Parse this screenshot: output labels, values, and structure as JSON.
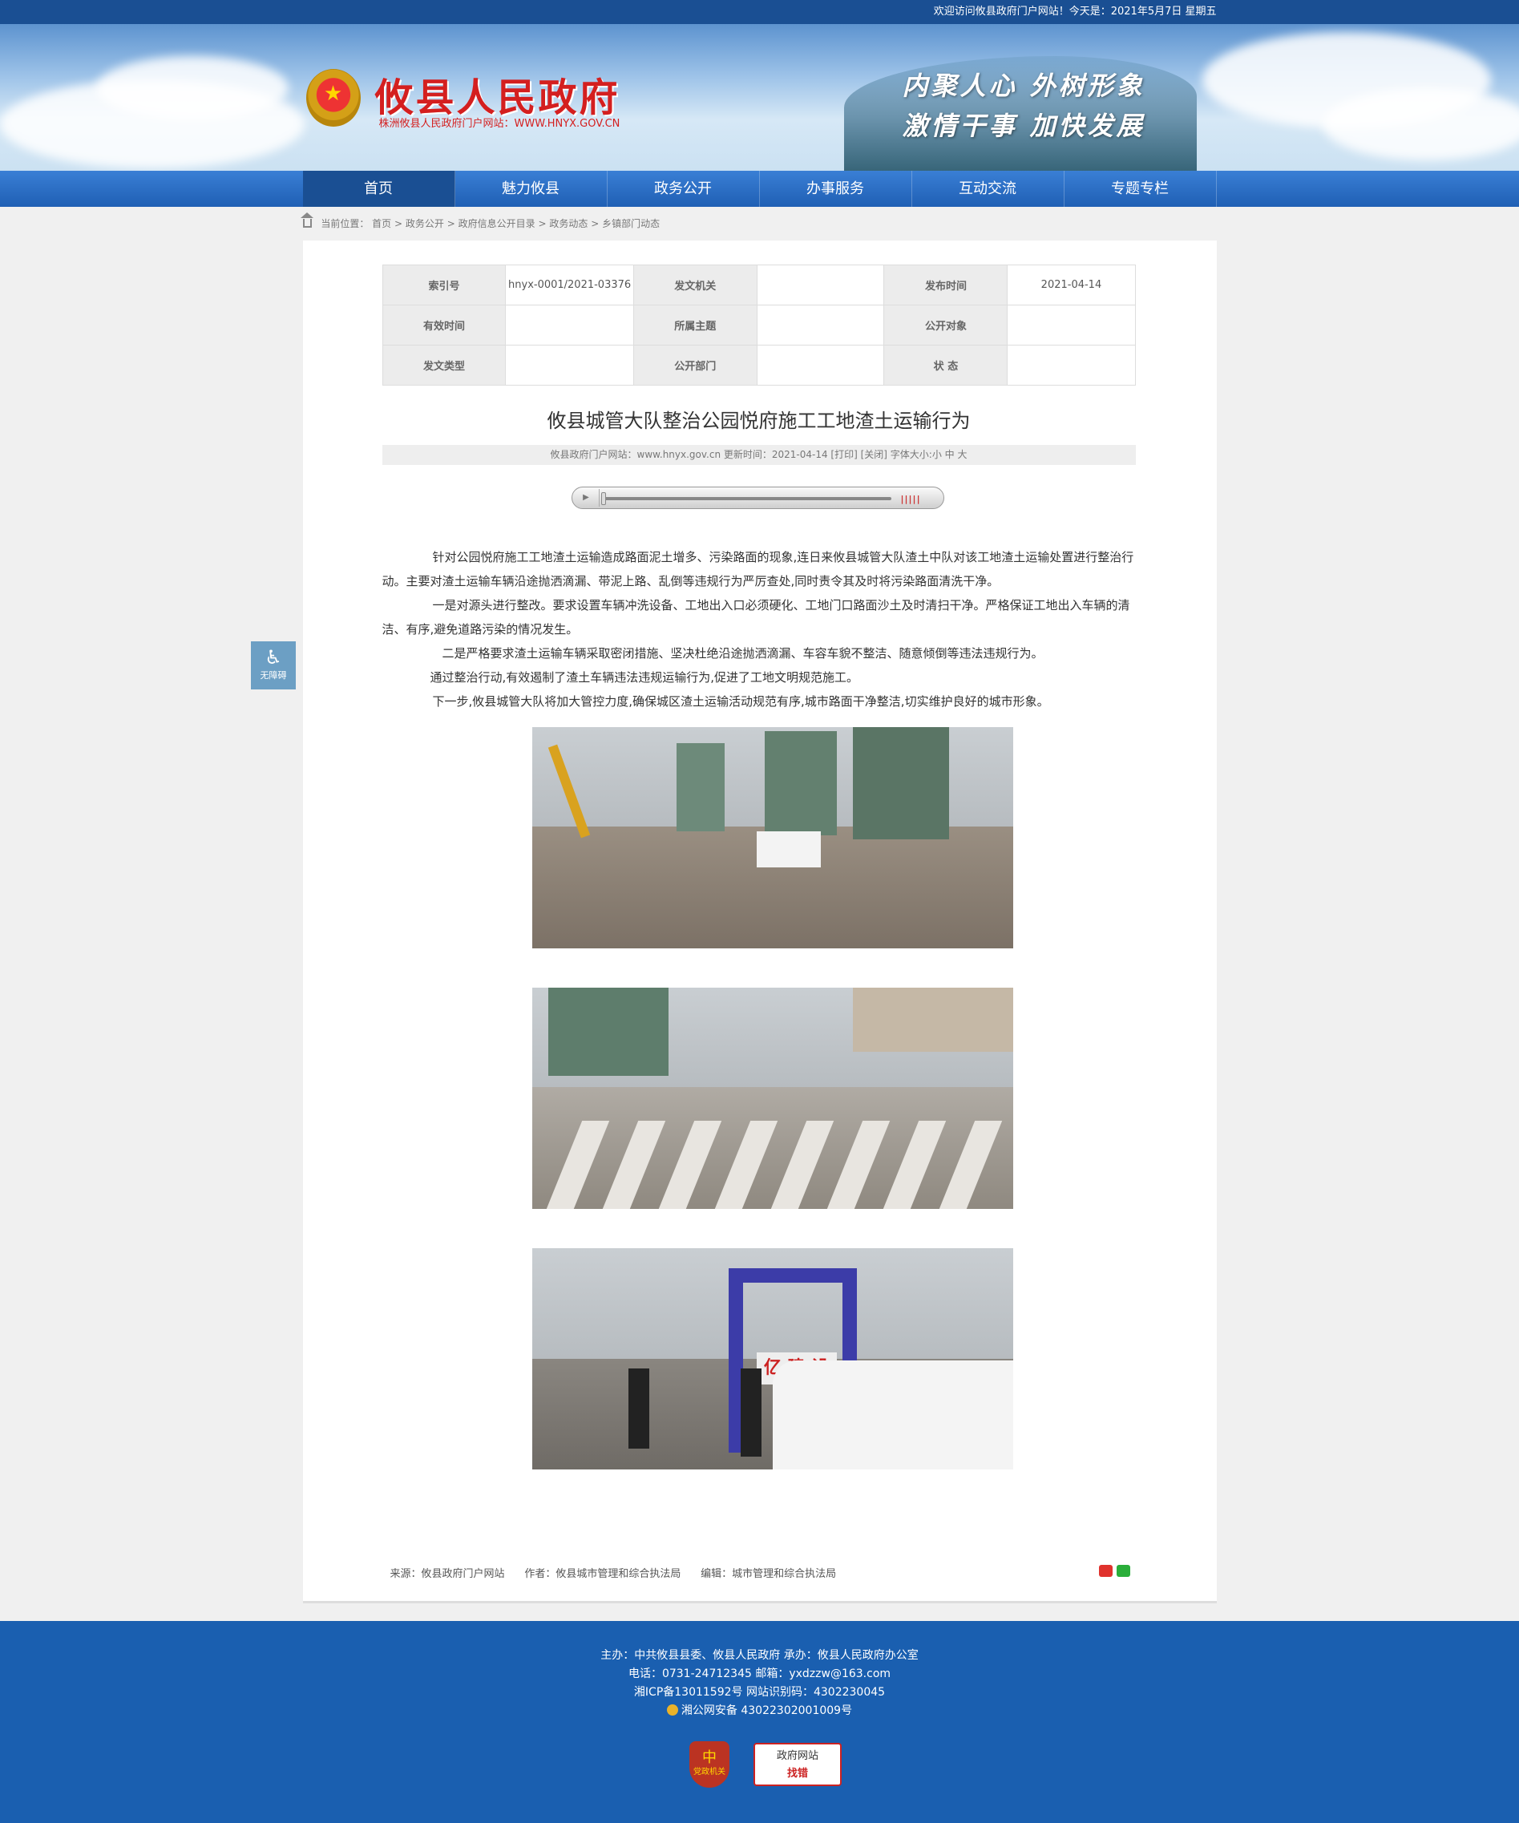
{
  "topbar": {
    "greeting": "欢迎访问攸县政府门户网站！今天是：2021年5月7日 星期五"
  },
  "header": {
    "site_name": "攸县人民政府",
    "site_sub": "株洲攸县人民政府门户网站：WWW.HNYX.GOV.CN",
    "slogan_1": "内聚人心 外树形象",
    "slogan_2": "激情干事 加快发展"
  },
  "nav": {
    "items": [
      "首页",
      "魅力攸县",
      "政务公开",
      "办事服务",
      "互动交流",
      "专题专栏"
    ],
    "active_index": 0
  },
  "breadcrumb": {
    "prefix": "当前位置：",
    "items": [
      "首页",
      "政务公开",
      "政府信息公开目录",
      "政务动态",
      "乡镇部门动态"
    ],
    "separator": ">"
  },
  "meta": {
    "rows": [
      [
        {
          "label": "索引号",
          "value": "hnyx-0001/2021-03376"
        },
        {
          "label": "发文机关",
          "value": ""
        },
        {
          "label": "发布时间",
          "value": "2021-04-14"
        }
      ],
      [
        {
          "label": "有效时间",
          "value": ""
        },
        {
          "label": "所属主题",
          "value": ""
        },
        {
          "label": "公开对象",
          "value": ""
        }
      ],
      [
        {
          "label": "发文类型",
          "value": ""
        },
        {
          "label": "公开部门",
          "value": ""
        },
        {
          "label": "状  态",
          "value": ""
        }
      ]
    ]
  },
  "article": {
    "title": "攸县城管大队整治公园悦府施工工地渣土运输行为",
    "info": "攸县政府门户网站：www.hnyx.gov.cn   更新时间：2021-04-14  [打印] [关闭]  字体大小:小 中 大",
    "player_play": "▶",
    "player_volume": "|||||",
    "paragraphs": [
      "针对公园悦府施工工地渣土运输造成路面泥土增多、污染路面的现象,连日来攸县城管大队渣土中队对该工地渣土运输处置进行整治行动。主要对渣土运输车辆沿途抛洒滴漏、带泥上路、乱倒等违规行为严厉查处,同时责令其及时将污染路面清洗干净。",
      "一是对源头进行整改。要求设置车辆冲洗设备、工地出入口必须硬化、工地门口路面沙土及时清扫干净。严格保证工地出入车辆的清洁、有序,避免道路污染的情况发生。",
      "二是严格要求渣土运输车辆采取密闭措施、坚决杜绝沿途抛洒滴漏、车容车貌不整洁、随意倾倒等违法违规行为。",
      "通过整治行动,有效遏制了渣土车辆违法违规运输行为,促进了工地文明规范施工。",
      "下一步,攸县城管大队将加大管控力度,确保城区渣土运输活动规范有序,城市路面干净整洁,切实维护良好的城市形象。"
    ],
    "photo3_sign": "亿 建 设",
    "source": "来源：攸县政府门户网站",
    "author": "作者：攸县城市管理和综合执法局",
    "editor": "编辑：城市管理和综合执法局"
  },
  "a11y": {
    "label": "无障碍",
    "icon": "wheelchair-icon"
  },
  "footer": {
    "line1": "主办：中共攸县县委、攸县人民政府 承办：攸县人民政府办公室",
    "line2": "电话：0731-24712345 邮箱：yxdzzw@163.com",
    "line3": "湘ICP备13011592号   网站识别码：4302230045",
    "line4": "湘公网安备 43022302001009号",
    "badge1": "党政机关",
    "badge2_top": "政府网站",
    "badge2_bottom": "找错"
  },
  "colors": {
    "brand_blue": "#1a4f93",
    "nav_blue": "#2a6fc4",
    "title_red": "#d41f1f",
    "footer_blue": "#1a5fb0"
  }
}
